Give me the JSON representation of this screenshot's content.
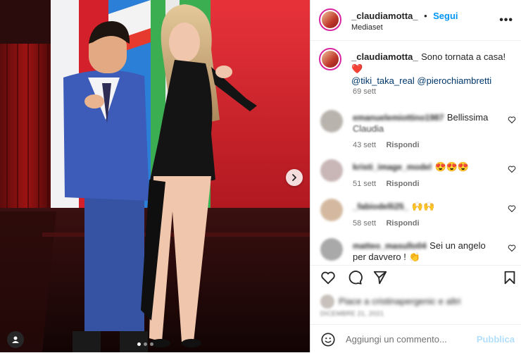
{
  "post": {
    "author": "_claudiamotta_",
    "follow_label": "Segui",
    "location": "Mediaset",
    "caption": "Sono tornata a casa!",
    "caption_emoji": "❤️",
    "mentions": "@tiki_taka_real @pierochiambretti",
    "caption_time": "69 sett"
  },
  "comments": [
    {
      "user": "emanuelemiottino1987",
      "text": "Bellissima",
      "text2": "Claudia",
      "time": "43 sett",
      "reply": "Rispondi"
    },
    {
      "user": "kristi_image_model",
      "text": "😍😍😍",
      "time": "51 sett",
      "reply": "Rispondi"
    },
    {
      "user": "_fabiodelli25_",
      "text": "🙌🙌",
      "time": "58 sett",
      "reply": "Rispondi"
    },
    {
      "user": "matteo_masullo04",
      "text": "Sei un angelo",
      "text2": "per davvero ! 👏",
      "time": "",
      "reply": ""
    }
  ],
  "likes_line": "Piace a cristinapergenic e altri",
  "date_line": "DICEMBRE 21, 2021",
  "add_comment_placeholder": "Aggiungi un commento...",
  "publish_label": "Pubblica",
  "colors": {
    "accent": "#0095f6",
    "publish_disabled": "#b2dffc"
  }
}
